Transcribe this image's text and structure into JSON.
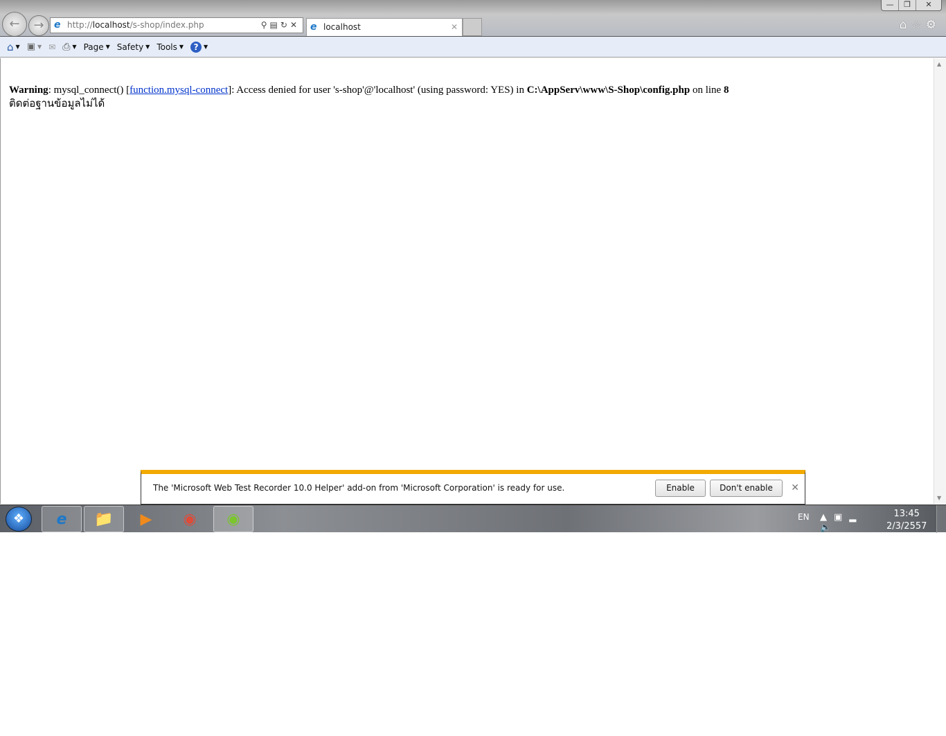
{
  "browser": {
    "address": {
      "prefix": "http://",
      "host": "localhost",
      "path": "/s-shop/index.php"
    },
    "tab": {
      "title": "localhost"
    },
    "command_bar": {
      "page": "Page",
      "safety": "Safety",
      "tools": "Tools"
    }
  },
  "page": {
    "warning_label": "Warning",
    "warning_pre": ": mysql_connect() [",
    "link_text": "function.mysql-connect",
    "warning_mid": "]: Access denied for user 's-shop'@'localhost' (using password: YES) in ",
    "file_path": "C:\\AppServ\\www\\S-Shop\\config.php",
    "on_line": " on line ",
    "line_number": "8",
    "thai_message": "ติดต่อฐานข้อมูลไม่ได้"
  },
  "notification": {
    "text": "The 'Microsoft Web Test Recorder 10.0 Helper' add-on from 'Microsoft Corporation' is ready for use.",
    "enable": "Enable",
    "dont_enable": "Don't enable",
    "accent": "#f2a900"
  },
  "taskbar": {
    "language": "EN",
    "time": "13:45",
    "date": "2/3/2557"
  }
}
